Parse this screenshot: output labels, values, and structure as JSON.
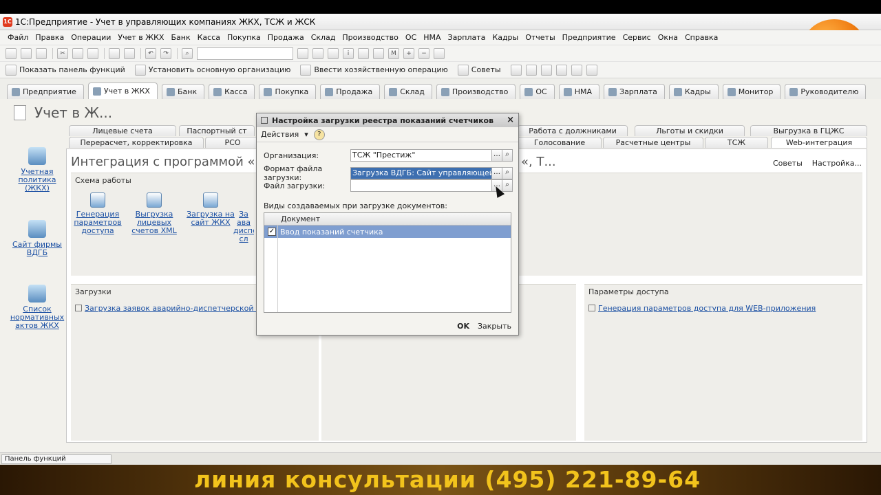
{
  "window": {
    "title": "1С:Предприятие - Учет в управляющих компаниях ЖКХ, ТСЖ и ЖСК",
    "logo_text": "1С"
  },
  "menu": [
    "Файл",
    "Правка",
    "Операции",
    "Учет в ЖКХ",
    "Банк",
    "Касса",
    "Покупка",
    "Продажа",
    "Склад",
    "Производство",
    "ОС",
    "НМА",
    "Зарплата",
    "Кадры",
    "Отчеты",
    "Предприятие",
    "Сервис",
    "Окна",
    "Справка"
  ],
  "toolbar2": {
    "show_panel": "Показать панель функций",
    "set_org": "Установить основную организацию",
    "enter_op": "Ввести хозяйственную операцию",
    "tips": "Советы"
  },
  "section_tabs": [
    "Предприятие",
    "Учет в ЖКХ",
    "Банк",
    "Касса",
    "Покупка",
    "Продажа",
    "Склад",
    "Производство",
    "ОС",
    "НМА",
    "Зарплата",
    "Кадры",
    "Монитор",
    "Руководителю"
  ],
  "page_heading": "Учет в Ж...",
  "left_nav": [
    "Учетная политика (ЖКХ)",
    "Сайт фирмы ВДГБ",
    "Список нормативных актов ЖКХ"
  ],
  "subtabs": {
    "row1": [
      "Лицевые счета",
      "Паспортный ст",
      "Работа с должниками",
      "Льготы и скидки",
      "Выгрузка в ГЦЖС"
    ],
    "row2": [
      "Перерасчет, корректировка",
      "РСО",
      "Голосование",
      "Расчетные центры",
      "ТСЖ",
      "Web-интеграция"
    ]
  },
  "panel": {
    "title_left": "Интеграция с программой «В",
    "title_right": "«, Т...",
    "help_tips": "Советы",
    "help_settings": "Настройка...",
    "schema_title": "Схема работы",
    "schema_items": [
      "Генерация параметров доступа",
      "Выгрузка лицевых счетов XML",
      "Загрузка на сайт ЖКХ",
      "За ава диспе сл"
    ],
    "loads_title": "Загрузки",
    "loads_link": "Загрузка заявок аварийно-диспетчерской службы",
    "access_title": "Параметры доступа",
    "access_link": "Генерация параметров доступа для WEB-приложения"
  },
  "dialog": {
    "title": "Настройка загрузки реестра показаний счетчиков",
    "actions": "Действия",
    "org_label": "Организация:",
    "org_value": "ТСЖ \"Престиж\"",
    "format_label": "Формат файла загрузки:",
    "format_value": "Загрузка ВДГБ: Сайт управляющей компа",
    "file_label": "Файл загрузки:",
    "file_value": "",
    "doc_types_label": "Виды создаваемых при загрузке документов:",
    "table_header": "Документ",
    "table_rows": [
      "Ввод показаний счетчика"
    ],
    "ok": "OK",
    "close": "Закрыть"
  },
  "func_panel": "Панель функций",
  "banner": "линия консультации (495) 221-89-64"
}
